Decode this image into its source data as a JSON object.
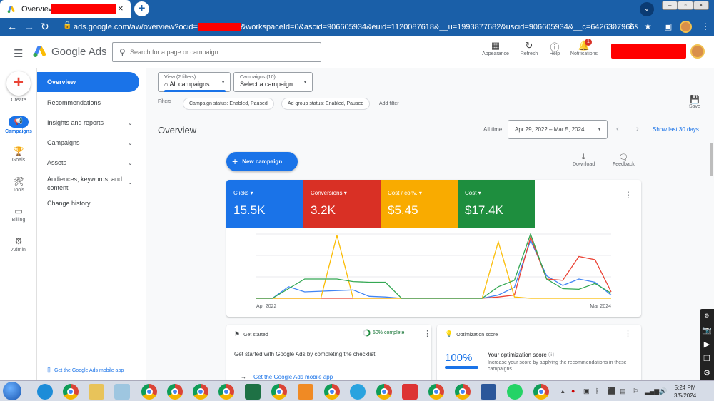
{
  "browser": {
    "tab_title": "Overview",
    "new_tab_symbol": "+",
    "url_prefix": "ads.google.com/aw/overview?ocid=",
    "url_suffix": "&workspaceId=0&ascid=906605934&euid=1120087618&__u=1993877682&uscid=906605934&__c=6426307966&..."
  },
  "header": {
    "brand": "Google Ads",
    "search_placeholder": "Search for a page or campaign",
    "actions": [
      {
        "label": "Appearance",
        "icon": "appearance-icon"
      },
      {
        "label": "Refresh",
        "icon": "refresh-icon"
      },
      {
        "label": "Help",
        "icon": "help-icon"
      },
      {
        "label": "Notifications",
        "icon": "bell-icon",
        "badge": "1"
      }
    ]
  },
  "rail": {
    "items": [
      {
        "label": "Create"
      },
      {
        "label": "Campaigns"
      },
      {
        "label": "Goals"
      },
      {
        "label": "Tools"
      },
      {
        "label": "Billing"
      },
      {
        "label": "Admin"
      }
    ]
  },
  "sidenav": {
    "items": [
      {
        "label": "Overview"
      },
      {
        "label": "Recommendations"
      },
      {
        "label": "Insights and reports"
      },
      {
        "label": "Campaigns"
      },
      {
        "label": "Assets"
      },
      {
        "label": "Audiences, keywords, and content"
      },
      {
        "label": "Change history"
      }
    ],
    "mobile_app": "Get the Google Ads mobile app"
  },
  "filters": {
    "view_label": "View (2 filters)",
    "view_value": "All campaigns",
    "campaigns_label": "Campaigns (10)",
    "campaigns_value": "Select a campaign",
    "filters_label": "Filters",
    "chips": [
      "Campaign status: Enabled, Paused",
      "Ad group status: Enabled, Paused"
    ],
    "add_filter": "Add filter",
    "save": "Save"
  },
  "overview": {
    "title": "Overview",
    "all_time": "All time",
    "date_range": "Apr 29, 2022 – Mar 5, 2024",
    "show_last": "Show last 30 days",
    "new_campaign": "New campaign",
    "download": "Download",
    "feedback": "Feedback"
  },
  "metrics": [
    {
      "label": "Clicks",
      "value": "15.5K",
      "color": "#1a73e8"
    },
    {
      "label": "Conversions",
      "value": "3.2K",
      "color": "#d93025"
    },
    {
      "label": "Cost / conv.",
      "value": "$5.45",
      "color": "#f9ab00"
    },
    {
      "label": "Cost",
      "value": "$17.4K",
      "color": "#1e8e3e"
    }
  ],
  "chart_data": {
    "type": "line",
    "x": [
      0,
      1,
      2,
      3,
      4,
      5,
      6,
      7,
      8,
      9,
      10,
      11,
      12,
      13,
      14,
      15,
      16,
      17,
      18,
      19,
      20,
      21,
      22
    ],
    "x_tick_labels": {
      "start": "Apr 2022",
      "end": "Mar 2024"
    },
    "series": [
      {
        "name": "Clicks",
        "color": "#4285f4",
        "values": [
          0,
          0,
          0.18,
          0.1,
          0.11,
          0.12,
          0.13,
          0.03,
          0.02,
          0,
          0,
          0,
          0,
          0,
          0,
          0.05,
          0.17,
          0.9,
          0.35,
          0.2,
          0.3,
          0.25,
          0.05
        ]
      },
      {
        "name": "Conversions",
        "color": "#ea4335",
        "values": [
          0,
          0,
          0,
          0,
          0,
          0,
          0,
          0,
          0,
          0,
          0,
          0,
          0,
          0,
          0,
          0.02,
          0.05,
          0.95,
          0.3,
          0.28,
          0.65,
          0.6,
          0.1
        ]
      },
      {
        "name": "Cost / conv.",
        "color": "#fbbc04",
        "values": [
          0,
          0,
          0,
          0,
          0,
          0.98,
          0,
          0,
          0,
          0,
          0,
          0,
          0,
          0,
          0,
          0.88,
          0.02,
          0,
          0,
          0,
          0,
          0,
          0
        ]
      },
      {
        "name": "Cost",
        "color": "#34a853",
        "values": [
          0,
          0,
          0.15,
          0.3,
          0.3,
          0.3,
          0.26,
          0.25,
          0.25,
          0,
          0,
          0,
          0,
          0,
          0,
          0.18,
          0.28,
          1.0,
          0.3,
          0.15,
          0.14,
          0.23,
          0.08
        ]
      }
    ]
  },
  "get_started": {
    "title": "Get started",
    "progress": "50% complete",
    "progress_fraction": 0.5,
    "description": "Get started with Google Ads by completing the checklist",
    "link": "Get the Google Ads mobile app"
  },
  "optimization": {
    "title": "Optimization score",
    "score": "100%",
    "score_title": "Your optimization score",
    "score_desc": "Increase your score by applying the recommendations in these campaigns"
  },
  "taskbar": {
    "time": "5:24 PM",
    "date": "3/5/2024"
  }
}
